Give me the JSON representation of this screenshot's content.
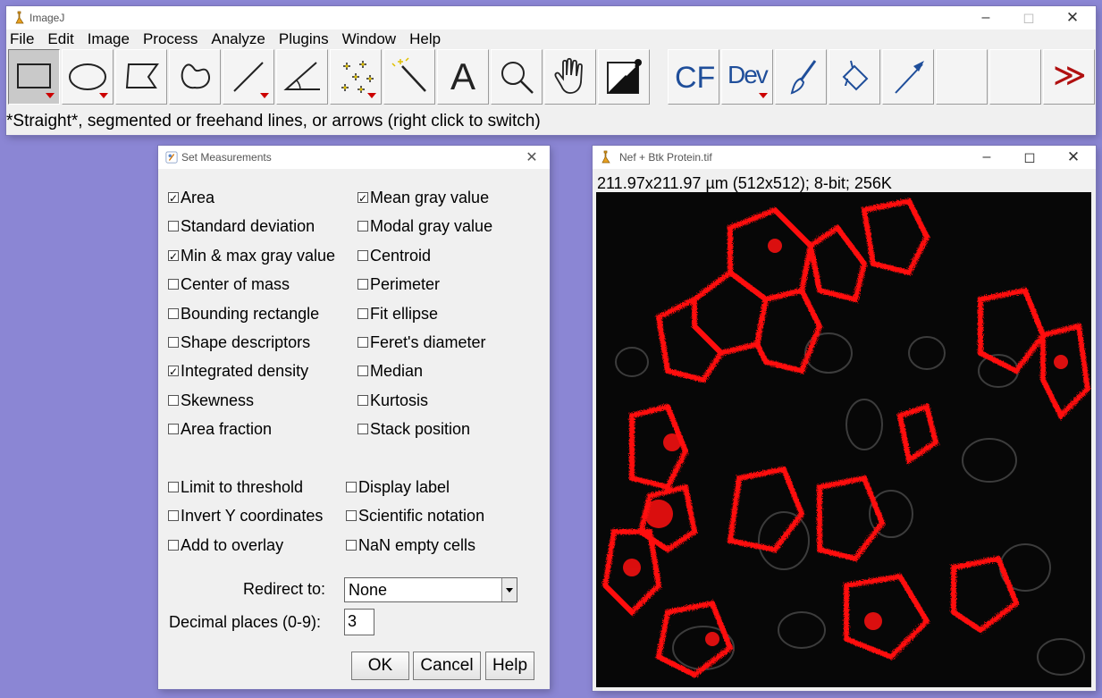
{
  "main_window": {
    "title": "ImageJ",
    "menus": [
      "File",
      "Edit",
      "Image",
      "Process",
      "Analyze",
      "Plugins",
      "Window",
      "Help"
    ],
    "tools": [
      {
        "name": "rectangle-tool",
        "label": ""
      },
      {
        "name": "oval-tool",
        "label": ""
      },
      {
        "name": "polygon-tool",
        "label": ""
      },
      {
        "name": "freehand-tool",
        "label": ""
      },
      {
        "name": "line-tool",
        "label": ""
      },
      {
        "name": "angle-tool",
        "label": ""
      },
      {
        "name": "multipoint-tool",
        "label": ""
      },
      {
        "name": "wand-tool",
        "label": ""
      },
      {
        "name": "text-tool",
        "label": "A"
      },
      {
        "name": "zoom-tool",
        "label": ""
      },
      {
        "name": "hand-tool",
        "label": ""
      },
      {
        "name": "color-picker-tool",
        "label": ""
      },
      {
        "name": "cf-tool",
        "label": "CF"
      },
      {
        "name": "dev-tool",
        "label": "Dev"
      },
      {
        "name": "brush-tool",
        "label": ""
      },
      {
        "name": "flood-fill-tool",
        "label": ""
      },
      {
        "name": "arrow-tool",
        "label": ""
      },
      {
        "name": "empty-slot-1",
        "label": ""
      },
      {
        "name": "empty-slot-2",
        "label": ""
      },
      {
        "name": "more-tools",
        "label": "≫"
      }
    ],
    "status": "*Straight*, segmented or freehand lines, or arrows (right click to switch)"
  },
  "set_measurements": {
    "title": "Set Measurements",
    "left_checks": [
      {
        "label": "Area",
        "checked": true
      },
      {
        "label": "Standard deviation",
        "checked": false
      },
      {
        "label": "Min & max gray value",
        "checked": true
      },
      {
        "label": "Center of mass",
        "checked": false
      },
      {
        "label": "Bounding rectangle",
        "checked": false
      },
      {
        "label": "Shape descriptors",
        "checked": false
      },
      {
        "label": "Integrated density",
        "checked": true
      },
      {
        "label": "Skewness",
        "checked": false
      },
      {
        "label": "Area fraction",
        "checked": false
      }
    ],
    "right_checks": [
      {
        "label": "Mean gray value",
        "checked": true
      },
      {
        "label": "Modal gray value",
        "checked": false
      },
      {
        "label": "Centroid",
        "checked": false
      },
      {
        "label": "Perimeter",
        "checked": false
      },
      {
        "label": "Fit ellipse",
        "checked": false
      },
      {
        "label": "Feret's diameter",
        "checked": false
      },
      {
        "label": "Median",
        "checked": false
      },
      {
        "label": "Kurtosis",
        "checked": false
      },
      {
        "label": "Stack position",
        "checked": false
      }
    ],
    "opt_left": [
      {
        "label": "Limit to threshold",
        "checked": false
      },
      {
        "label": "Invert Y coordinates",
        "checked": false
      },
      {
        "label": "Add to overlay",
        "checked": false
      }
    ],
    "opt_right": [
      {
        "label": "Display label",
        "checked": false
      },
      {
        "label": "Scientific notation",
        "checked": false
      },
      {
        "label": "NaN empty cells",
        "checked": false
      }
    ],
    "redirect_label": "Redirect to:",
    "redirect_value": "None",
    "decimal_label": "Decimal places (0-9):",
    "decimal_value": "3",
    "ok": "OK",
    "cancel": "Cancel",
    "help": "Help"
  },
  "image_window": {
    "title": "Nef + Btk Protein.tif",
    "info": "211.97x211.97 µm (512x512); 8-bit; 256K"
  },
  "colors": {
    "desktop": "#8b86d4",
    "signal": "#ff1010",
    "toolbar_blue": "#1f4e9a"
  }
}
